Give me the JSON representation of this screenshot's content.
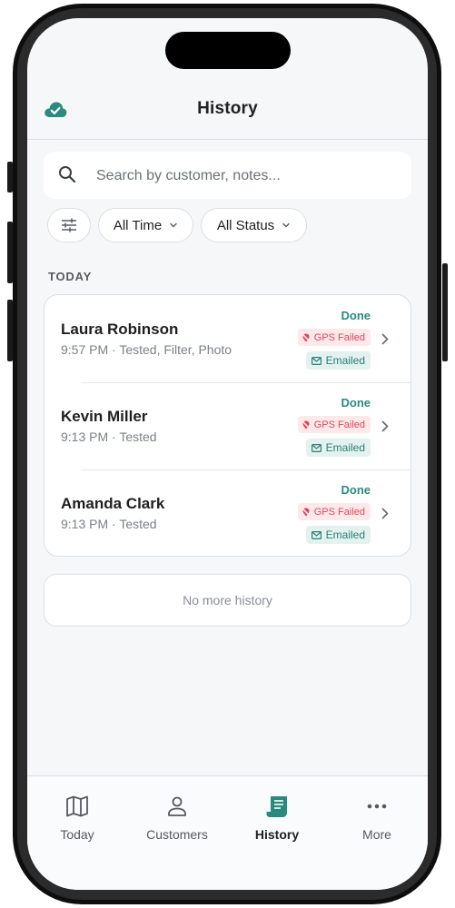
{
  "header": {
    "title": "History",
    "sync_icon": "cloud-check-icon"
  },
  "search": {
    "placeholder": "Search by customer, notes..."
  },
  "filters": {
    "time_label": "All Time",
    "status_label": "All Status"
  },
  "section": {
    "label": "TODAY"
  },
  "entries": [
    {
      "name": "Laura Robinson",
      "detail": "9:57 PM · Tested, Filter, Photo",
      "status": "Done",
      "gps": "GPS Failed",
      "email": "Emailed"
    },
    {
      "name": "Kevin Miller",
      "detail": "9:13 PM · Tested",
      "status": "Done",
      "gps": "GPS Failed",
      "email": "Emailed"
    },
    {
      "name": "Amanda Clark",
      "detail": "9:13 PM · Tested",
      "status": "Done",
      "gps": "GPS Failed",
      "email": "Emailed"
    }
  ],
  "footer_note": "No more history",
  "tabs": [
    {
      "label": "Today",
      "icon": "map-icon"
    },
    {
      "label": "Customers",
      "icon": "person-icon"
    },
    {
      "label": "History",
      "icon": "receipt-icon"
    },
    {
      "label": "More",
      "icon": "more-dots-icon"
    }
  ],
  "colors": {
    "accent": "#2b8a7e",
    "gps_failed": "#e0485a",
    "emailed": "#2b7f75"
  }
}
